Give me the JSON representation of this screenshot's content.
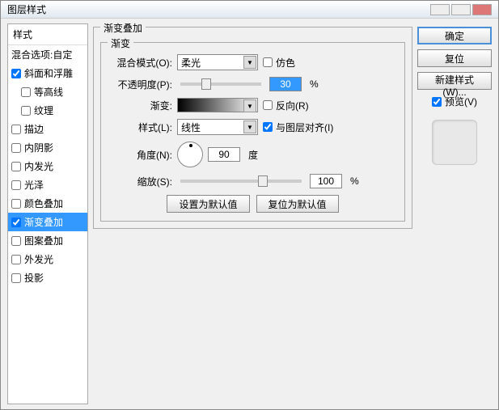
{
  "window": {
    "title": "图层样式"
  },
  "sidebar": {
    "header": "样式",
    "blend_options": "混合选项:自定",
    "items": [
      {
        "label": "斜面和浮雕",
        "checked": true
      },
      {
        "label": "等高线",
        "checked": false,
        "sub": true
      },
      {
        "label": "纹理",
        "checked": false,
        "sub": true
      },
      {
        "label": "描边",
        "checked": false
      },
      {
        "label": "内阴影",
        "checked": false
      },
      {
        "label": "内发光",
        "checked": false
      },
      {
        "label": "光泽",
        "checked": false
      },
      {
        "label": "颜色叠加",
        "checked": false
      },
      {
        "label": "渐变叠加",
        "checked": true,
        "selected": true
      },
      {
        "label": "图案叠加",
        "checked": false
      },
      {
        "label": "外发光",
        "checked": false
      },
      {
        "label": "投影",
        "checked": false
      }
    ]
  },
  "panel": {
    "title": "渐变叠加",
    "group": "渐变",
    "blend_mode_label": "混合模式(O):",
    "blend_mode_value": "柔光",
    "dither": "仿色",
    "opacity_label": "不透明度(P):",
    "opacity_value": "30",
    "percent": "%",
    "gradient_label": "渐变:",
    "reverse": "反向(R)",
    "style_label": "样式(L):",
    "style_value": "线性",
    "align": "与图层对齐(I)",
    "angle_label": "角度(N):",
    "angle_value": "90",
    "angle_unit": "度",
    "scale_label": "缩放(S):",
    "scale_value": "100",
    "set_default": "设置为默认值",
    "reset_default": "复位为默认值"
  },
  "buttons": {
    "ok": "确定",
    "cancel": "复位",
    "new_style": "新建样式(W)...",
    "preview": "预览(V)"
  }
}
